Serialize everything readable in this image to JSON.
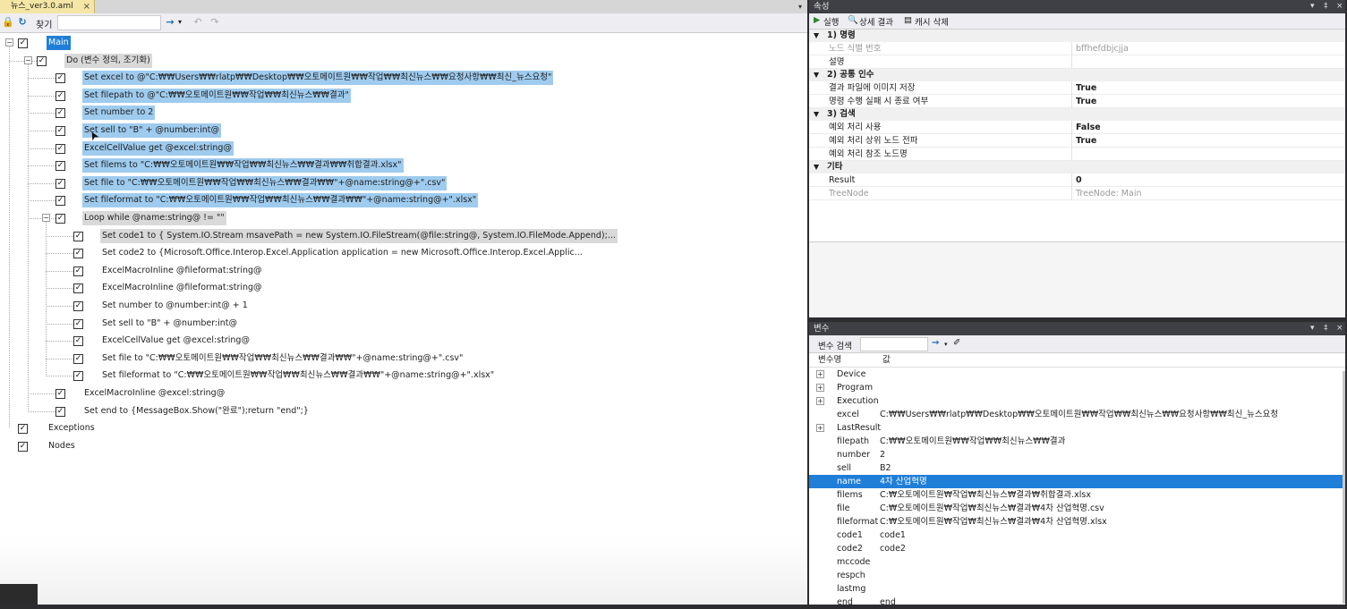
{
  "editor": {
    "tab_title": "뉴스_ver3.0.aml",
    "tab_close": "×",
    "tab_dropdown": "▾",
    "toolbar": {
      "lock_icon": "🔒",
      "refresh_icon": "↻",
      "find_label": "찾기",
      "find_value": "",
      "go_icon": "→",
      "go_dropdown": "▾",
      "undo_icon": "↶",
      "redo_icon": "↷"
    },
    "tree": [
      {
        "text": "Main",
        "style": "blue",
        "expander": "−"
      },
      {
        "text": "Do (변수 정의, 조기화)",
        "style": "gray",
        "expander": "−"
      },
      {
        "text": "Set excel to @\"C:₩₩Users₩₩rlatp₩₩Desktop₩₩오토메이트원₩₩작업₩₩최신뉴스₩₩요청사항₩₩최신_뉴스요청\"",
        "style": "sel"
      },
      {
        "text": "Set filepath to @\"C:₩₩오토메이트원₩₩작업₩₩최신뉴스₩₩결과\"",
        "style": "sel"
      },
      {
        "text": "Set number to 2",
        "style": "sel"
      },
      {
        "text": "Set sell to \"B\" + @number:int@",
        "style": "sel"
      },
      {
        "text": "ExcelCellValue get @excel:string@",
        "style": "sel"
      },
      {
        "text": "Set filems to \"C:₩₩오토메이트원₩₩작업₩₩최신뉴스₩₩결과₩₩취합결과.xlsx\"",
        "style": "sel"
      },
      {
        "text": "Set file to \"C:₩₩오토메이트원₩₩작업₩₩최신뉴스₩₩결과₩₩\"+@name:string@+\".csv\"",
        "style": "sel"
      },
      {
        "text": "Set fileformat to \"C:₩₩오토메이트원₩₩작업₩₩최신뉴스₩₩결과₩₩\"+@name:string@+\".xlsx\"",
        "style": "sel"
      },
      {
        "text": "Loop while @name:string@ != \"\"",
        "style": "gray",
        "expander": "−"
      },
      {
        "text": "Set code1 to { System.IO.Stream msavePath = new System.IO.FileStream(@file:string@, System.IO.FileMode.Append);...",
        "style": "gray"
      },
      {
        "text": "Set code2 to {Microsoft.Office.Interop.Excel.Application application = new Microsoft.Office.Interop.Excel.Applic...",
        "style": ""
      },
      {
        "text": "ExcelMacroInline @fileformat:string@",
        "style": ""
      },
      {
        "text": "ExcelMacroInline @fileformat:string@",
        "style": ""
      },
      {
        "text": "Set number to @number:int@ + 1",
        "style": ""
      },
      {
        "text": "Set sell to \"B\" + @number:int@",
        "style": ""
      },
      {
        "text": "ExcelCellValue get @excel:string@",
        "style": ""
      },
      {
        "text": "Set file to \"C:₩₩오토메이트원₩₩작업₩₩최신뉴스₩₩결과₩₩\"+@name:string@+\".csv\"",
        "style": ""
      },
      {
        "text": "Set fileformat to \"C:₩₩오토메이트원₩₩작업₩₩최신뉴스₩₩결과₩₩\"+@name:string@+\".xlsx\"",
        "style": ""
      },
      {
        "text": "ExcelMacroInline @excel:string@",
        "style": ""
      },
      {
        "text": "Set end to {MessageBox.Show(\"완료\");return \"end\";}",
        "style": ""
      },
      {
        "text": "Exceptions",
        "style": ""
      },
      {
        "text": "Nodes",
        "style": ""
      }
    ]
  },
  "properties": {
    "title": "속성",
    "title_controls": [
      "▾",
      "‡",
      "×"
    ],
    "toolbar": {
      "run": "실행",
      "detail": "상세 결과",
      "cache": "캐시 삭제"
    },
    "categories": [
      {
        "toggle": "▲",
        "name": "1) 명령",
        "rows": [
          {
            "name": "노드 식별 번호",
            "value": "bffhefdbjcjja",
            "bold": false,
            "dim": true
          },
          {
            "name": "설명",
            "value": "",
            "bold": false,
            "dim": false
          }
        ]
      },
      {
        "toggle": "▲",
        "name": "2) 공통 인수",
        "rows": [
          {
            "name": "결과 파일에 이미지 저장",
            "value": "True",
            "bold": true,
            "dim": false
          },
          {
            "name": "명령 수행 실패 시 종료 여부",
            "value": "True",
            "bold": true,
            "dim": false
          }
        ]
      },
      {
        "toggle": "▲",
        "name": "3) 검색",
        "rows": [
          {
            "name": "예외 처리 사용",
            "value": "False",
            "bold": true,
            "dim": false
          },
          {
            "name": "예외 처리 상위 노드 전파",
            "value": "True",
            "bold": true,
            "dim": false
          },
          {
            "name": "예외 처리 참조 노드명",
            "value": "",
            "bold": false,
            "dim": false
          }
        ]
      },
      {
        "toggle": "▲",
        "name": "기타",
        "rows": [
          {
            "name": "Result",
            "value": "0",
            "bold": true,
            "dim": false
          },
          {
            "name": "TreeNode",
            "value": "TreeNode: Main",
            "bold": false,
            "dim": true
          }
        ]
      }
    ]
  },
  "variables": {
    "title": "변수",
    "title_controls": [
      "▾",
      "‡",
      "×"
    ],
    "search_label": "변수 검색",
    "search_value": "",
    "col_name": "변수명",
    "col_value": "값",
    "rows": [
      {
        "expander": "+",
        "name": "Device",
        "value": ""
      },
      {
        "expander": "+",
        "name": "Program",
        "value": ""
      },
      {
        "expander": "+",
        "name": "Execution",
        "value": ""
      },
      {
        "expander": "",
        "name": "excel",
        "value": "C:₩₩Users₩₩rlatp₩₩Desktop₩₩오토메이트원₩₩작업₩₩최신뉴스₩₩요청사항₩₩최신_뉴스요청"
      },
      {
        "expander": "+",
        "name": "LastResult",
        "value": ""
      },
      {
        "expander": "",
        "name": "filepath",
        "value": "C:₩₩오토메이트원₩₩작업₩₩최신뉴스₩₩결과"
      },
      {
        "expander": "",
        "name": "number",
        "value": "2"
      },
      {
        "expander": "",
        "name": "sell",
        "value": "B2"
      },
      {
        "expander": "",
        "name": "name",
        "value": "4차 산업혁명",
        "selected": true
      },
      {
        "expander": "",
        "name": "filems",
        "value": "C:₩오토메이트원₩작업₩최신뉴스₩결과₩취합결과.xlsx"
      },
      {
        "expander": "",
        "name": "file",
        "value": "C:₩오토메이트원₩작업₩최신뉴스₩결과₩4차 산업혁명.csv"
      },
      {
        "expander": "",
        "name": "fileformat",
        "value": "C:₩오토메이트원₩작업₩최신뉴스₩결과₩4차 산업혁명.xlsx"
      },
      {
        "expander": "",
        "name": "code1",
        "value": "code1"
      },
      {
        "expander": "",
        "name": "code2",
        "value": "code2"
      },
      {
        "expander": "",
        "name": "mccode",
        "value": ""
      },
      {
        "expander": "",
        "name": "respch",
        "value": ""
      },
      {
        "expander": "",
        "name": "lastmg",
        "value": ""
      },
      {
        "expander": "",
        "name": "end",
        "value": "end"
      }
    ]
  }
}
